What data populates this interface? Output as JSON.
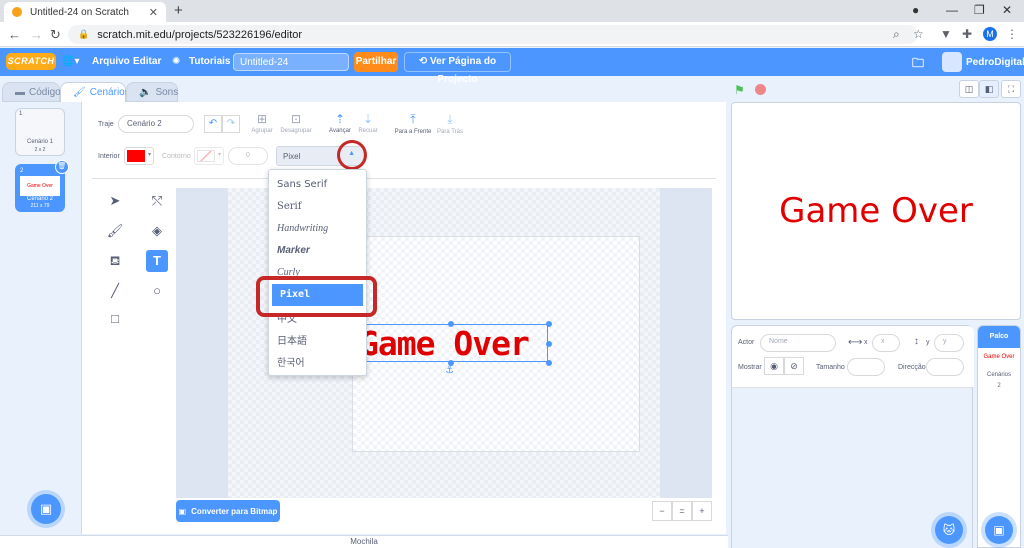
{
  "browser": {
    "tab_title": "Untitled-24 on Scratch",
    "url": "scratch.mit.edu/projects/523226196/editor",
    "profile_initial": "M"
  },
  "menubar": {
    "logo": "SCRATCH",
    "items": [
      "Arquivo",
      "Editar",
      "Tutoriais"
    ],
    "project_title": "Untitled-24",
    "share_label": "Partilhar",
    "view_project_label": "Ver Página do Projecto",
    "username": "PedroDigital"
  },
  "editor_tabs": [
    "Código",
    "Cenários",
    "Sons"
  ],
  "costumes": [
    {
      "num": "1",
      "name": "Cenário 1",
      "size": "2 x 2",
      "thumb_text": ""
    },
    {
      "num": "2",
      "name": "Cenário 2",
      "size": "211 x 79",
      "thumb_text": "Game Over"
    }
  ],
  "paint": {
    "costume_label": "Traje",
    "costume_name": "Cenário 2",
    "tools_top": [
      "Agrupar",
      "Desagrupar",
      "Avançar",
      "Recuar",
      "Para a Frente",
      "Para Trás"
    ],
    "fill_label": "Interior",
    "outline_label": "Contorno",
    "outline_width": "0",
    "font_selected": "Pixel",
    "fill_color": "#ff0000",
    "canvas_text": "Game Over",
    "convert_label": "Converter para Bitmap",
    "zoom_buttons": [
      "−",
      "=",
      "+"
    ]
  },
  "font_dropdown": [
    "Sans Serif",
    "Serif",
    "Handwriting",
    "Marker",
    "Curly",
    "Pixel",
    "中文",
    "日本語",
    "한국어"
  ],
  "stage": {
    "text": "Game Over",
    "text_color": "#e00000"
  },
  "sprite_info": {
    "actor_label": "Actor",
    "name_placeholder": "Nome",
    "x_label": "x",
    "y_label": "y",
    "x_placeholder": "x",
    "y_placeholder": "y",
    "show_label": "Mostrar",
    "size_label": "Tamanho",
    "direction_label": "Direcção"
  },
  "palco": {
    "title": "Palco",
    "thumb_text": "Game Over",
    "backdrops_label": "Cenários",
    "backdrops_count": "2"
  },
  "mochila": "Mochila",
  "colors": {
    "accent": "#4c97ff",
    "share": "#ff8c1a",
    "highlight": "#c62828"
  }
}
